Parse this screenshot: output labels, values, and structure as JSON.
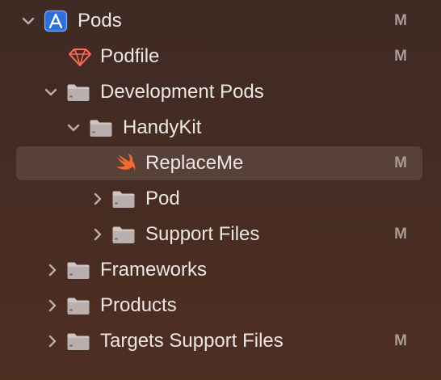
{
  "project_navigator": {
    "items": [
      {
        "label": "Pods",
        "status": "M"
      },
      {
        "label": "Podfile",
        "status": "M"
      },
      {
        "label": "Development Pods",
        "status": ""
      },
      {
        "label": "HandyKit",
        "status": ""
      },
      {
        "label": "ReplaceMe",
        "status": "M"
      },
      {
        "label": "Pod",
        "status": ""
      },
      {
        "label": "Support Files",
        "status": "M"
      },
      {
        "label": "Frameworks",
        "status": ""
      },
      {
        "label": "Products",
        "status": ""
      },
      {
        "label": "Targets Support Files",
        "status": "M"
      }
    ],
    "selected_item": "ReplaceMe"
  },
  "icons": {
    "project": "xcode-project-icon",
    "podfile": "ruby-gem-icon",
    "folder": "folder-icon",
    "swift": "swift-file-icon",
    "expanded": "chevron-down-icon",
    "collapsed": "chevron-right-icon"
  },
  "colors": {
    "selection": "#5a4440",
    "project_icon": "#2f6fda",
    "ruby_icon": "#ff6b57",
    "swift_icon": "#f56a2f",
    "folder": "#b9afae",
    "status": "#a89c98"
  }
}
